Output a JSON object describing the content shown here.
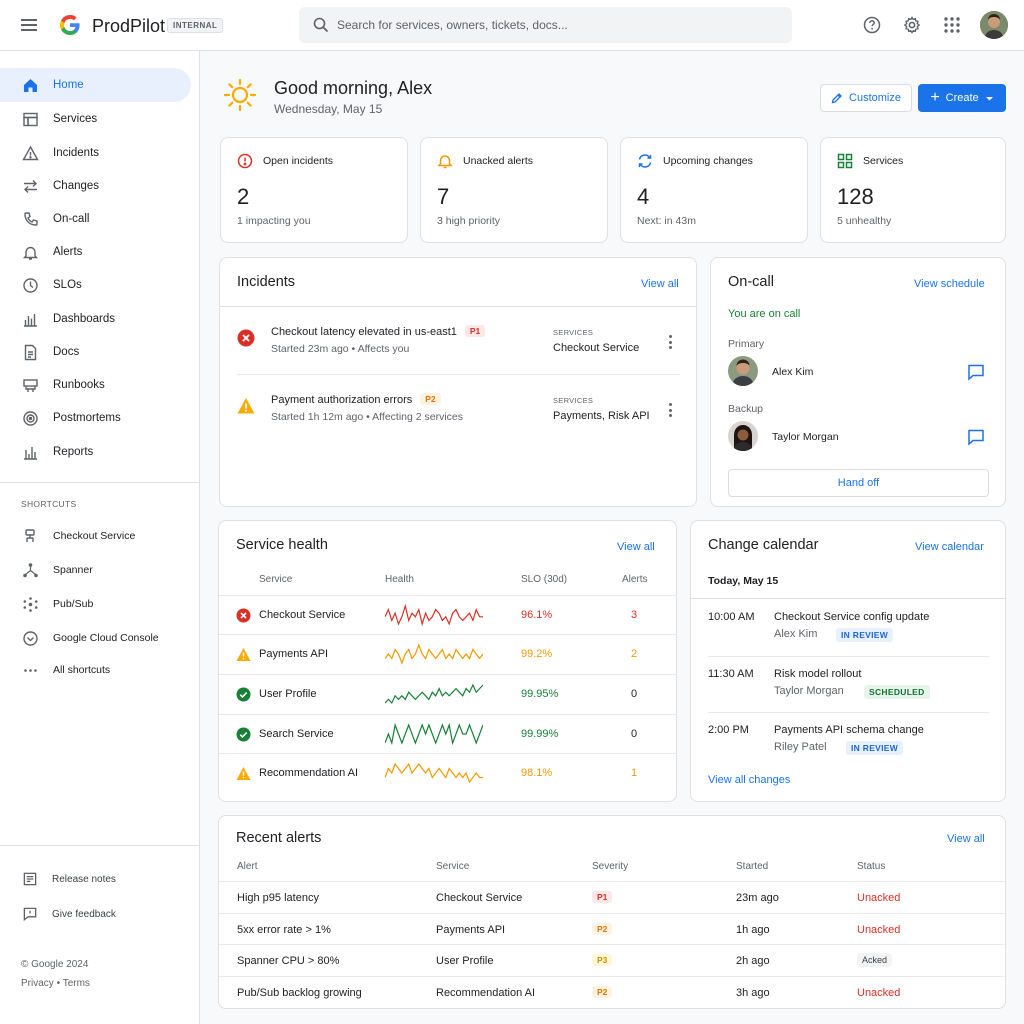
{
  "app": {
    "name": "ProdPilot",
    "badge": "INTERNAL"
  },
  "search": {
    "placeholder": "Search for services, owners, tickets, docs..."
  },
  "sidebar": {
    "nav": [
      {
        "label": "Home",
        "icon": "home-icon"
      },
      {
        "label": "Services",
        "icon": "services-icon"
      },
      {
        "label": "Incidents",
        "icon": "warning-triangle-icon"
      },
      {
        "label": "Changes",
        "icon": "swap-arrows-icon"
      },
      {
        "label": "On-call",
        "icon": "phone-icon"
      },
      {
        "label": "Alerts",
        "icon": "bell-icon"
      },
      {
        "label": "SLOs",
        "icon": "clock-icon"
      },
      {
        "label": "Dashboards",
        "icon": "dashboard-icon"
      },
      {
        "label": "Docs",
        "icon": "document-icon"
      },
      {
        "label": "Runbooks",
        "icon": "runbook-icon"
      },
      {
        "label": "Postmortems",
        "icon": "target-icon"
      },
      {
        "label": "Reports",
        "icon": "bar-chart-icon"
      }
    ],
    "shortcuts_heading": "SHORTCUTS",
    "shortcuts": [
      {
        "label": "Checkout Service",
        "icon": "service-node-icon"
      },
      {
        "label": "Spanner",
        "icon": "spanner-icon"
      },
      {
        "label": "Pub/Sub",
        "icon": "pubsub-icon"
      },
      {
        "label": "Google Cloud Console",
        "icon": "cloud-console-icon"
      },
      {
        "label": "All shortcuts",
        "icon": "more-horiz-icon"
      }
    ],
    "release_notes": "Release notes",
    "feedback": "Give feedback",
    "copyright": "© Google 2024",
    "privacy": "Privacy",
    "terms": "Terms"
  },
  "header": {
    "greeting": "Good morning, Alex",
    "date": "Wednesday, May 15",
    "customize": "Customize",
    "create": "Create"
  },
  "stats": [
    {
      "title": "Open incidents",
      "value": "2",
      "sub": "1 impacting you",
      "icon": "alert-circle-icon"
    },
    {
      "title": "Unacked alerts",
      "value": "7",
      "sub": "3 high priority",
      "icon": "bell-icon"
    },
    {
      "title": "Upcoming changes",
      "value": "4",
      "sub": "Next: in 43m",
      "icon": "sync-icon"
    },
    {
      "title": "Services",
      "value": "128",
      "sub": "5 unhealthy",
      "icon": "grid-icon"
    }
  ],
  "incidents": {
    "title": "Incidents",
    "view_all": "View all",
    "services_label": "SERVICES",
    "items": [
      {
        "title": "Checkout latency elevated in us-east1",
        "priority": "P1",
        "started": "Started 23m ago",
        "impact": "Affects you",
        "services": "Checkout Service"
      },
      {
        "title": "Payment authorization errors",
        "priority": "P2",
        "started": "Started 1h 12m ago",
        "impact": "Affecting 2 services",
        "services": "Payments, Risk API"
      }
    ]
  },
  "oncall": {
    "title": "On-call",
    "view_schedule": "View schedule",
    "status": "You are on call",
    "primary_label": "Primary",
    "primary_name": "Alex Kim",
    "backup_label": "Backup",
    "backup_name": "Taylor Morgan",
    "hand_off": "Hand off"
  },
  "service_health": {
    "title": "Service health",
    "view_all": "View all",
    "columns": [
      "Service",
      "Health",
      "SLO (30d)",
      "Alerts"
    ],
    "rows": [
      {
        "name": "Checkout Service",
        "status": "error",
        "slo": "96.1%",
        "alerts": "3",
        "spark": [
          6,
          8,
          5,
          7,
          4,
          6,
          9,
          5,
          7,
          6,
          8,
          4,
          7,
          5,
          6,
          8,
          7,
          5,
          6,
          4,
          7,
          8,
          6,
          5,
          6,
          7,
          5,
          8,
          6,
          6
        ]
      },
      {
        "name": "Payments API",
        "status": "warning",
        "slo": "99.2%",
        "alerts": "2",
        "spark": [
          5,
          6,
          5,
          7,
          6,
          4,
          6,
          7,
          5,
          6,
          8,
          6,
          5,
          7,
          6,
          5,
          6,
          7,
          5,
          6,
          5,
          7,
          6,
          5,
          6,
          5,
          7,
          6,
          5,
          6
        ]
      },
      {
        "name": "User Profile",
        "status": "ok",
        "slo": "99.95%",
        "alerts": "0",
        "spark": [
          3,
          4,
          3,
          5,
          4,
          5,
          4,
          6,
          5,
          4,
          5,
          6,
          5,
          4,
          6,
          5,
          7,
          5,
          6,
          5,
          6,
          7,
          6,
          5,
          7,
          6,
          8,
          6,
          7,
          8
        ]
      },
      {
        "name": "Search Service",
        "status": "ok",
        "slo": "99.99%",
        "alerts": "0",
        "spark": [
          5,
          6,
          5,
          7,
          6,
          5,
          6,
          7,
          6,
          5,
          6,
          7,
          6,
          7,
          6,
          5,
          6,
          7,
          6,
          7,
          5,
          6,
          7,
          6,
          6,
          7,
          6,
          5,
          6,
          7
        ]
      },
      {
        "name": "Recommendation AI",
        "status": "warning",
        "slo": "98.1%",
        "alerts": "1",
        "spark": [
          5,
          7,
          6,
          8,
          7,
          6,
          7,
          8,
          6,
          7,
          8,
          7,
          6,
          7,
          5,
          6,
          7,
          6,
          5,
          7,
          6,
          5,
          6,
          5,
          6,
          4,
          5,
          6,
          5,
          5
        ]
      }
    ]
  },
  "change_calendar": {
    "title": "Change calendar",
    "view_calendar": "View calendar",
    "day": "Today, May 15",
    "items": [
      {
        "time": "10:00 AM",
        "title": "Checkout Service config update",
        "owner": "Alex Kim",
        "badge": "IN REVIEW",
        "badge_type": "review"
      },
      {
        "time": "11:30 AM",
        "title": "Risk model rollout",
        "owner": "Taylor Morgan",
        "badge": "SCHEDULED",
        "badge_type": "scheduled"
      },
      {
        "time": "2:00 PM",
        "title": "Payments API schema change",
        "owner": "Riley Patel",
        "badge": "IN REVIEW",
        "badge_type": "review"
      }
    ],
    "view_all_changes": "View all changes"
  },
  "recent_alerts": {
    "title": "Recent alerts",
    "view_all": "View all",
    "columns": [
      "Alert",
      "Service",
      "Severity",
      "Started",
      "Status"
    ],
    "rows": [
      {
        "alert": "High p95 latency",
        "service": "Checkout Service",
        "severity": "P1",
        "started": "23m ago",
        "status": "Unacked"
      },
      {
        "alert": "5xx error rate > 1%",
        "service": "Payments API",
        "severity": "P2",
        "started": "1h ago",
        "status": "Unacked"
      },
      {
        "alert": "Spanner CPU > 80%",
        "service": "User Profile",
        "severity": "P3",
        "started": "2h ago",
        "status": "Acked"
      },
      {
        "alert": "Pub/Sub backlog growing",
        "service": "Recommendation AI",
        "severity": "P2",
        "started": "3h ago",
        "status": "Unacked"
      }
    ]
  },
  "colors": {
    "accent": "#1a73e8",
    "error": "#d93025",
    "warning": "#f29900",
    "ok": "#188038"
  }
}
